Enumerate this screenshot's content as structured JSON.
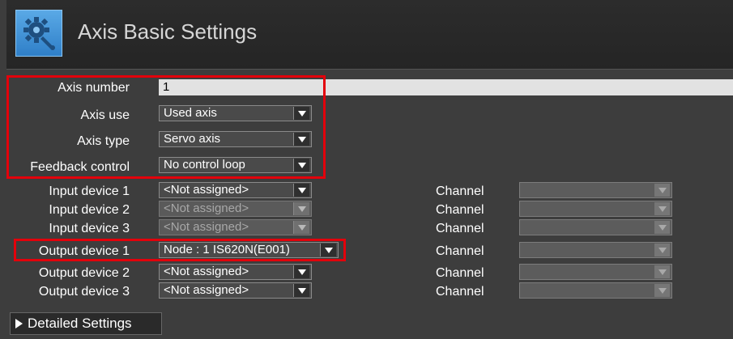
{
  "header": {
    "title": "Axis Basic Settings",
    "icon": "gear-icon"
  },
  "fields": {
    "axis_number": {
      "label": "Axis number",
      "value": "1"
    },
    "axis_use": {
      "label": "Axis use",
      "value": "Used axis"
    },
    "axis_type": {
      "label": "Axis type",
      "value": "Servo axis"
    },
    "feedback_control": {
      "label": "Feedback control",
      "value": "No control loop"
    }
  },
  "devices": [
    {
      "label": "Input device 1",
      "value": "<Not assigned>",
      "channel_label": "Channel"
    },
    {
      "label": "Input device 2",
      "value": "<Not assigned>",
      "channel_label": "Channel"
    },
    {
      "label": "Input device 3",
      "value": "<Not assigned>",
      "channel_label": "Channel"
    },
    {
      "label": "Output device 1",
      "value": "Node : 1 IS620N(E001)",
      "channel_label": "Channel"
    },
    {
      "label": "Output device 2",
      "value": "<Not assigned>",
      "channel_label": "Channel"
    },
    {
      "label": "Output device 3",
      "value": "<Not assigned>",
      "channel_label": "Channel"
    }
  ],
  "detailed_settings": {
    "label": "Detailed Settings"
  },
  "colors": {
    "highlight": "#e3000b",
    "accent": "#3a8fd6",
    "background": "#3d3d3d"
  }
}
